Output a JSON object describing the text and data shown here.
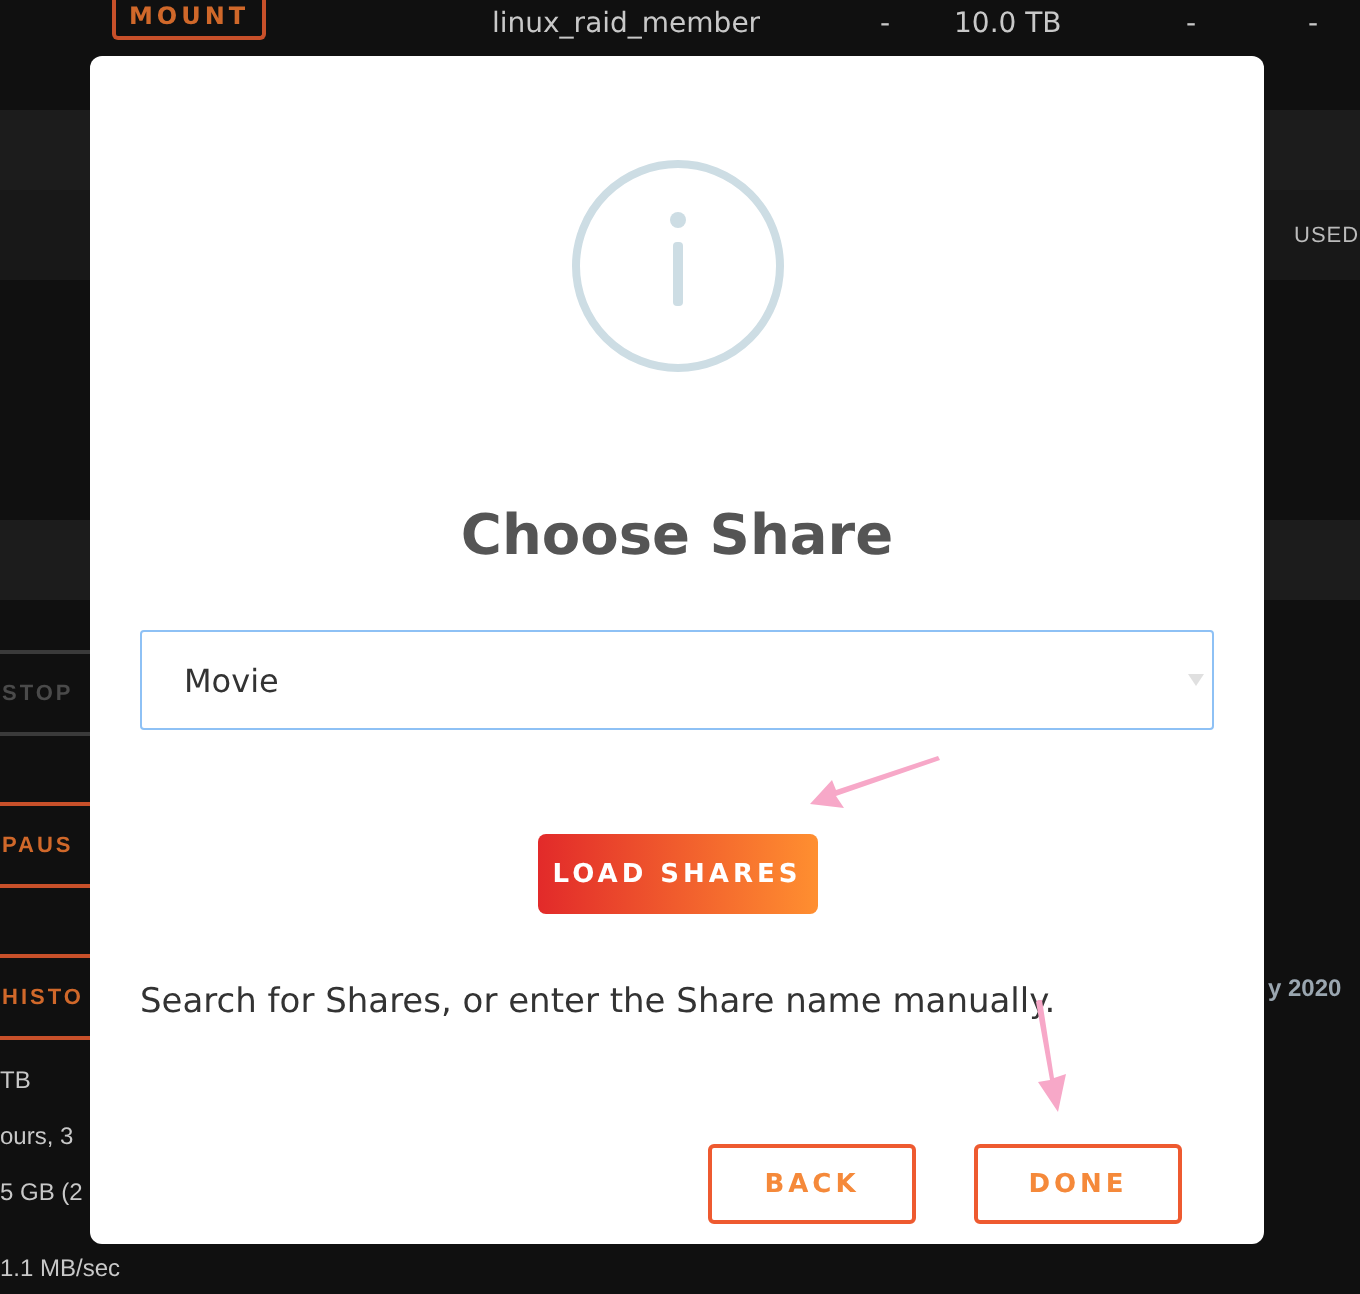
{
  "background": {
    "row": {
      "button": "MOUNT",
      "type": "linux_raid_member",
      "cells": [
        "-",
        "10.0 TB",
        "-",
        "-"
      ]
    },
    "header": "USED",
    "left_buttons": [
      {
        "label": "STOP",
        "disabled": true
      },
      {
        "label": "PAUS",
        "disabled": false
      },
      {
        "label": "HISTO",
        "disabled": false
      }
    ],
    "left_texts": [
      "TB",
      "ours, 3",
      "5 GB (2",
      "1.1 MB/sec"
    ],
    "right_text": "y 2020"
  },
  "dialog": {
    "title": "Choose Share",
    "share_select": {
      "value": "Movie"
    },
    "load_button": "LOAD SHARES",
    "hint": "Search for Shares, or enter the Share name manually.",
    "buttons": [
      "BACK",
      "DONE"
    ]
  }
}
